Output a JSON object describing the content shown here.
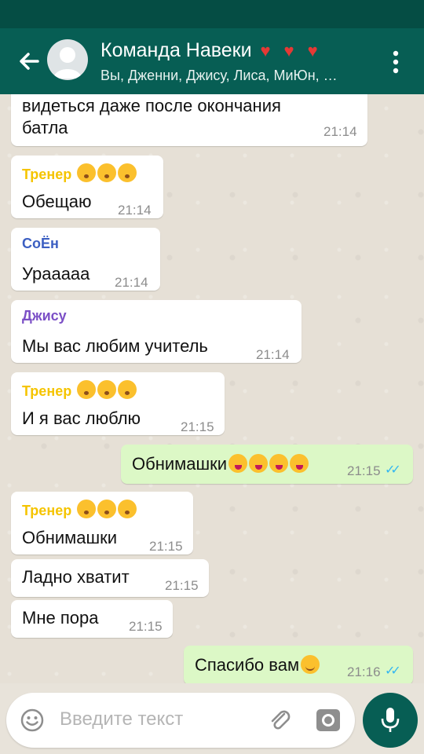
{
  "header": {
    "title": "Команда Навеки",
    "title_icons": [
      "kiss-lips-icon",
      "kiss-lips-icon",
      "kiss-lips-icon"
    ],
    "subtitle": "Вы, Дженни, Джису, Лиса, МиЮн, …"
  },
  "colors": {
    "header": "#075e54",
    "outgoing_bubble": "#dcf8c6",
    "incoming_bubble": "#ffffff",
    "trainer_name": "#f5c400",
    "soyeon_name": "#3c5fc2",
    "jisoo_name": "#7b4fc6",
    "read_ticks": "#34b7f1"
  },
  "messages": [
    {
      "type": "in",
      "text_line1": "видеться даже после окончания",
      "text_line2": "батла",
      "time": "21:14"
    },
    {
      "type": "in",
      "sender": "Тренер",
      "sender_emojis": [
        "kissing-face-icon",
        "kissing-face-icon",
        "kissing-face-icon"
      ],
      "text": "Обещаю",
      "time": "21:14"
    },
    {
      "type": "in",
      "sender": "СоЁн",
      "text": "Урааааа",
      "time": "21:14"
    },
    {
      "type": "in",
      "sender": "Джису",
      "text": "Мы вас любим  учитель",
      "time": "21:14"
    },
    {
      "type": "in",
      "sender": "Тренер",
      "sender_emojis": [
        "kissing-face-icon",
        "kissing-face-icon",
        "kissing-face-icon"
      ],
      "text": "И я вас люблю",
      "time": "21:15"
    },
    {
      "type": "out",
      "text": "Обнимашки",
      "emojis": [
        "winking-tongue-face-icon",
        "winking-tongue-face-icon",
        "winking-tongue-face-icon",
        "winking-tongue-face-icon"
      ],
      "time": "21:15",
      "status": "read"
    },
    {
      "type": "in",
      "sender": "Тренер",
      "sender_emojis": [
        "kissing-face-icon",
        "kissing-face-icon",
        "kissing-face-icon"
      ],
      "text": "Обнимашки",
      "time": "21:15"
    },
    {
      "type": "in",
      "text": "Ладно хватит",
      "time": "21:15"
    },
    {
      "type": "in",
      "text": "Мне пора",
      "time": "21:15"
    },
    {
      "type": "out",
      "text": "Спасибо вам",
      "emojis": [
        "smiling-face-icon"
      ],
      "time": "21:16",
      "status": "read"
    }
  ],
  "input": {
    "placeholder": "Введите текст"
  }
}
